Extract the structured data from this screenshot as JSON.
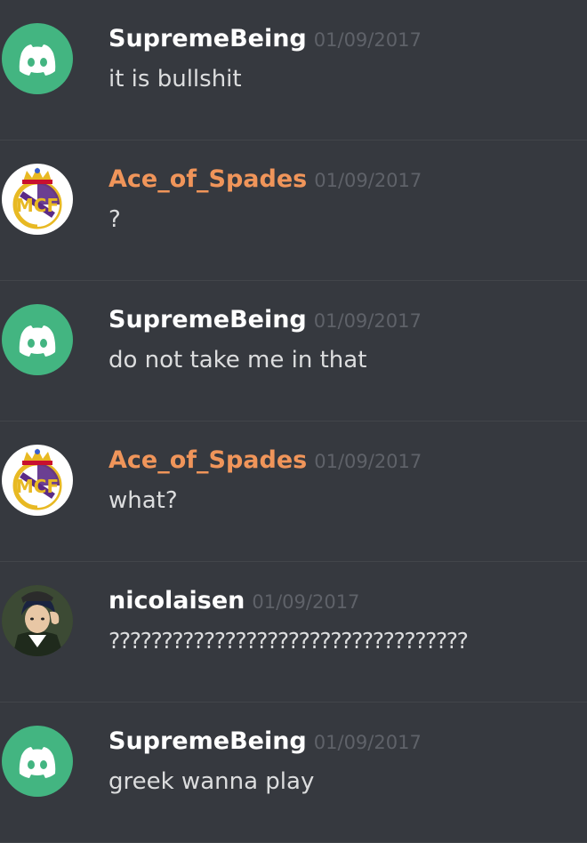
{
  "colors": {
    "background": "#36393f",
    "divider": "#42454a",
    "discord_green": "#43b581",
    "ace_orange": "#f0955a",
    "timestamp": "#5f6269",
    "message_text": "#dcddde"
  },
  "messages": [
    {
      "username": "SupremeBeing",
      "timestamp": "01/09/2017",
      "text": "it is bullshit",
      "avatar": "discord-default-avatar",
      "name_color": "#ffffff"
    },
    {
      "username": "Ace_of_Spades",
      "timestamp": "01/09/2017",
      "text": "?",
      "avatar": "real-madrid-crest-avatar",
      "name_color": "#f0955a"
    },
    {
      "username": "SupremeBeing",
      "timestamp": "01/09/2017",
      "text": "do not take me in that",
      "avatar": "discord-default-avatar",
      "name_color": "#ffffff"
    },
    {
      "username": "Ace_of_Spades",
      "timestamp": "01/09/2017",
      "text": "what?",
      "avatar": "real-madrid-crest-avatar",
      "name_color": "#f0955a"
    },
    {
      "username": "nicolaisen",
      "timestamp": "01/09/2017",
      "text": "??????????????????????????????????",
      "avatar": "anime-character-avatar",
      "name_color": "#ffffff"
    },
    {
      "username": "SupremeBeing",
      "timestamp": "01/09/2017",
      "text": "greek wanna play",
      "avatar": "discord-default-avatar",
      "name_color": "#ffffff"
    }
  ]
}
